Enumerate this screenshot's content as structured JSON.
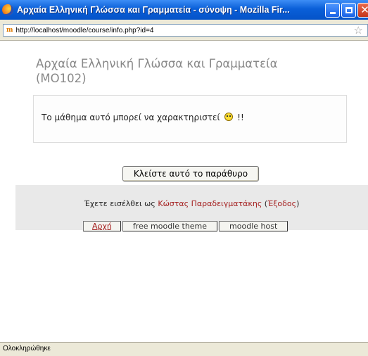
{
  "window": {
    "title": "Αρχαία Ελληνική Γλώσσα και Γραμματεία - σύνοψη - Mozilla Fir..."
  },
  "addressbar": {
    "url": "http://localhost/moodle/course/info.php?id=4",
    "site_icon_text": "m"
  },
  "page": {
    "course_title": "Αρχαία Ελληνική Γλώσσα και Γραμματεία (MO102)",
    "summary_text": "Το μάθημα αυτό μπορεί να χαρακτηριστεί",
    "summary_suffix": "!!",
    "close_button": "Κλείστε αυτό το παράθυρο"
  },
  "footer": {
    "login_prefix": "Έχετε εισέλθει ως",
    "user_name": "Κώστας Παραδειγματάκης",
    "logout_open": "(",
    "logout_label": "Έξοδος",
    "logout_close": ")",
    "links": [
      "Αρχή",
      "free moodle theme",
      "moodle host"
    ]
  },
  "status": {
    "text": "Ολοκληρώθηκε"
  },
  "icons": {
    "app": "firefox-icon",
    "site": "moodle-favicon",
    "bookmark": "star-icon",
    "emoticon": "smiley-icon"
  },
  "colors": {
    "titlebar": "#0a5fd8",
    "link": "#a31b1b",
    "course_title": "#888888",
    "footer_bg": "#e9e9e9"
  }
}
